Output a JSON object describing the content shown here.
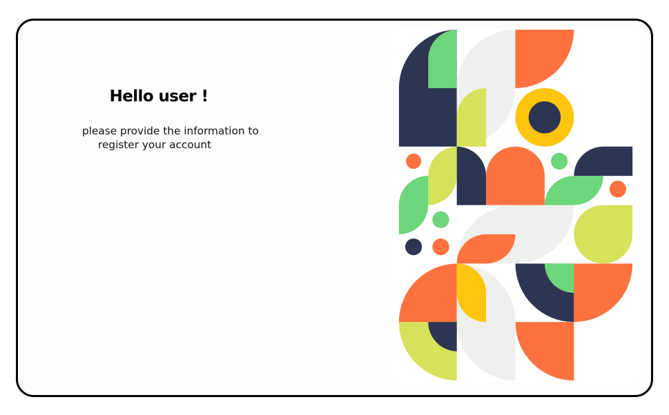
{
  "greeting": {
    "title": "Hello user !",
    "subtitle_line1": "please provide the information to",
    "subtitle_line2": "register your account"
  },
  "colors": {
    "navy": "#2d3553",
    "green": "#6dd57a",
    "orange": "#fe7240",
    "yellow": "#fec50c",
    "lime": "#d5e25a",
    "light_gray": "#eef0ee",
    "border": "#000000"
  },
  "illustration": {
    "name": "geometric-pattern-illustration"
  }
}
